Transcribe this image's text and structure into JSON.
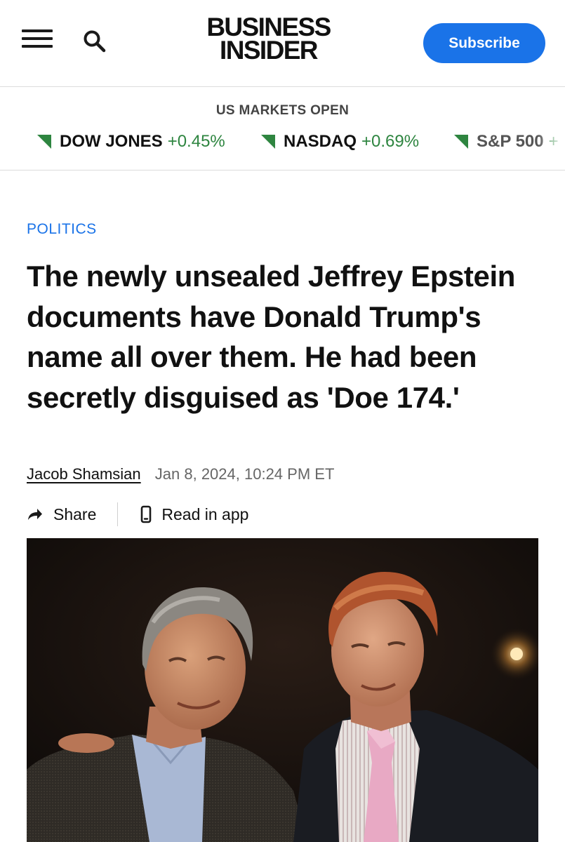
{
  "header": {
    "logo_line1": "BUSINESS",
    "logo_line2": "INSIDER",
    "subscribe_label": "Subscribe",
    "menu_icon": "hamburger-menu-icon",
    "search_icon": "search-icon"
  },
  "markets": {
    "status": "US MARKETS OPEN",
    "tickers": [
      {
        "name": "DOW JONES",
        "change": "+0.45%",
        "direction": "up"
      },
      {
        "name": "NASDAQ",
        "change": "+0.69%",
        "direction": "up"
      },
      {
        "name": "S&P 500",
        "change": "+",
        "direction": "up"
      }
    ],
    "up_color": "#2e8540"
  },
  "article": {
    "category": "POLITICS",
    "headline": "The newly unsealed Jeffrey Epstein documents have Donald Trump's name all over them. He had been secretly disguised as 'Doe 174.'",
    "author": "Jacob Shamsian",
    "date": "Jan 8, 2024, 10:24 PM ET",
    "share_label": "Share",
    "read_in_app_label": "Read in app"
  },
  "colors": {
    "accent": "#1a73e8",
    "text": "#111111",
    "muted": "#666666"
  }
}
